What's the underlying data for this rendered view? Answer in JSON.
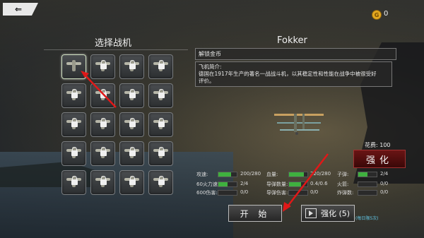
{
  "header": {
    "back_label": "",
    "coin_value": "0"
  },
  "left_panel": {
    "title": "选择战机",
    "aircraft": [
      {
        "name": "plane-1",
        "locked": false
      },
      {
        "name": "plane-2",
        "locked": true
      },
      {
        "name": "plane-3",
        "locked": true
      },
      {
        "name": "plane-4",
        "locked": true
      },
      {
        "name": "plane-5",
        "locked": true
      },
      {
        "name": "plane-6",
        "locked": true
      },
      {
        "name": "plane-7",
        "locked": true
      },
      {
        "name": "plane-8",
        "locked": true
      },
      {
        "name": "plane-9",
        "locked": true
      },
      {
        "name": "plane-10",
        "locked": true
      },
      {
        "name": "plane-11",
        "locked": true
      },
      {
        "name": "plane-12",
        "locked": true
      },
      {
        "name": "plane-13",
        "locked": true
      },
      {
        "name": "plane-14",
        "locked": true
      },
      {
        "name": "plane-15",
        "locked": true
      },
      {
        "name": "plane-16",
        "locked": true
      },
      {
        "name": "plane-17",
        "locked": true
      },
      {
        "name": "plane-18",
        "locked": true
      },
      {
        "name": "plane-19",
        "locked": true
      },
      {
        "name": "plane-20",
        "locked": true
      }
    ]
  },
  "right_panel": {
    "title": "Fokker",
    "name_bar": "解锁金币",
    "desc_line1": "飞机简介:",
    "desc_line2": "德国在1917年生产的著名一战战斗机，以其稳定性和性能在战争中被很受好",
    "desc_line3": "评价。",
    "cost": "花费: 100",
    "upgrade_label": "强化",
    "stats": [
      {
        "label": "攻速:",
        "value": "200/280",
        "fill": 0.71
      },
      {
        "label": "血量:",
        "value": "220/280",
        "fill": 0.79
      },
      {
        "label": "子弹:",
        "value": "2/4",
        "fill": 0.5
      },
      {
        "label": "60火力速:",
        "value": "2/4",
        "fill": 0.5
      },
      {
        "label": "导弹数量:",
        "value": "0.4/0.6",
        "fill": 0.67
      },
      {
        "label": "火箭:",
        "value": "0/0",
        "fill": 0
      },
      {
        "label": "600伤害:",
        "value": "0/0",
        "fill": 0
      },
      {
        "label": "导弹伤害:",
        "value": "0/0",
        "fill": 0
      },
      {
        "label": "炸弹数:",
        "value": "0/0",
        "fill": 0
      }
    ],
    "start_label": "开 始",
    "video_upgrade_label": "强化 (5)",
    "daily_note": "(每日限5次)"
  },
  "colors": {
    "accent_red": "#6a1414",
    "bar_green": "#3fb03f",
    "note_blue": "#62c8e8"
  }
}
